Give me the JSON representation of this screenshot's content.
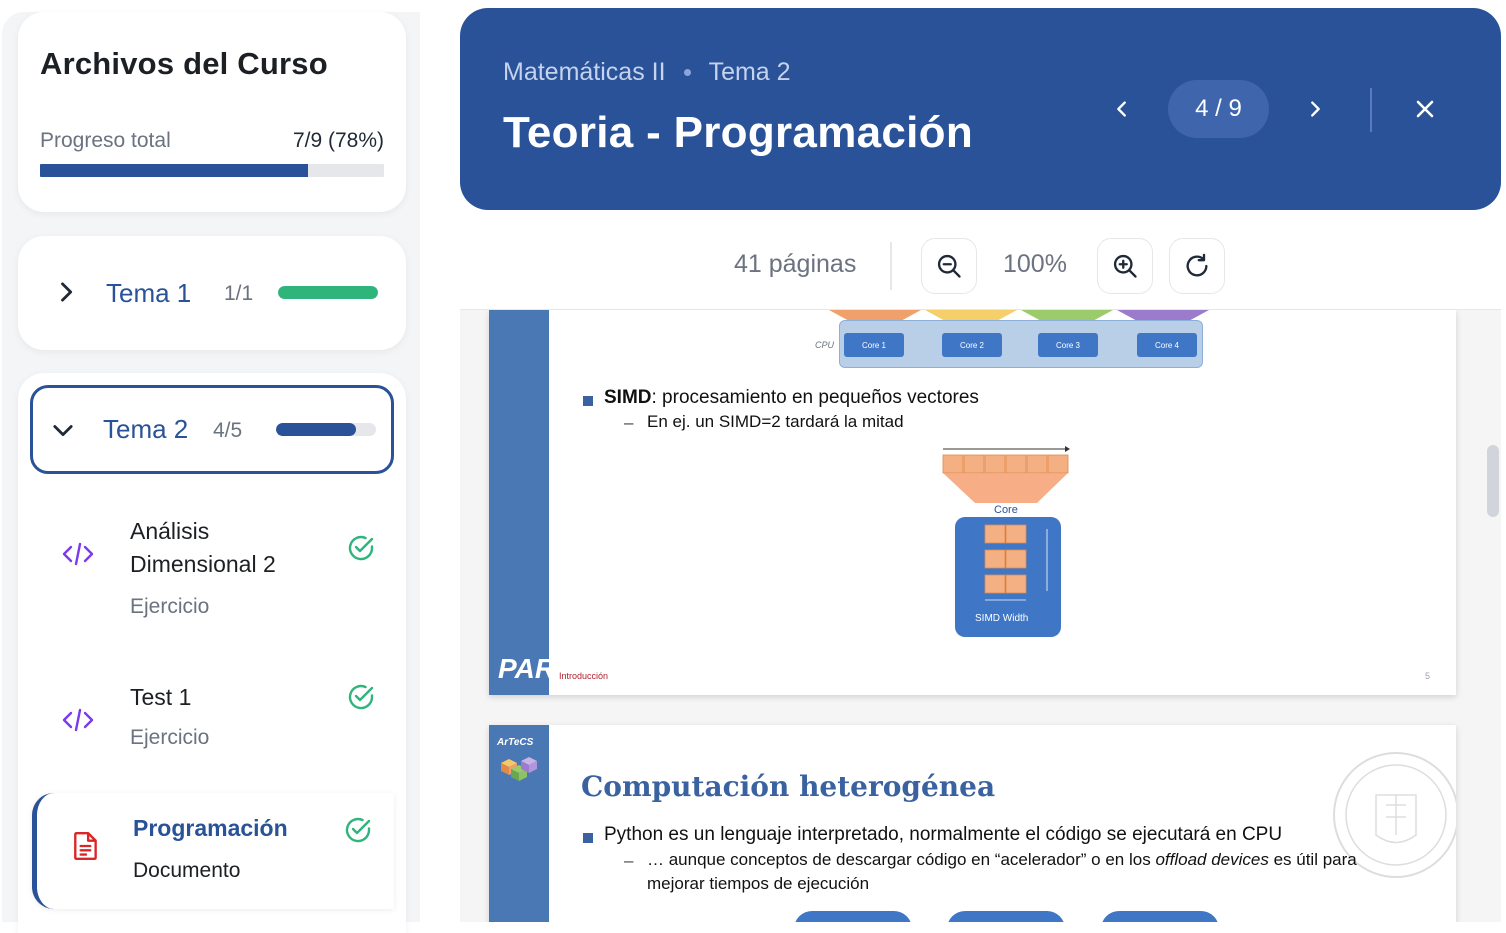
{
  "sidebar": {
    "title": "Archivos del Curso",
    "progress": {
      "label": "Progreso total",
      "value_text": "7/9 (78%)",
      "fraction": 0.78
    },
    "temas": [
      {
        "name": "Tema 1",
        "count": "1/1",
        "fraction": 1.0,
        "color": "#2fb47c",
        "expanded": false
      },
      {
        "name": "Tema 2",
        "count": "4/5",
        "fraction": 0.8,
        "color": "#2a5298",
        "expanded": true
      }
    ],
    "items": [
      {
        "title": "Análisis Dimensional 2",
        "type": "Ejercicio",
        "icon": "code-icon",
        "completed": true
      },
      {
        "title": "Test 1",
        "type": "Ejercicio",
        "icon": "code-icon",
        "completed": true
      },
      {
        "title": "Programación",
        "type": "Documento",
        "icon": "document-icon",
        "completed": true,
        "active": true
      }
    ]
  },
  "header": {
    "breadcrumb": [
      "Matemáticas II",
      "Tema 2"
    ],
    "title": "Teoria - Programación",
    "page_indicator": "4 / 9"
  },
  "viewer": {
    "pages_label": "41 páginas",
    "zoom_label": "100%"
  },
  "slides": {
    "slide1": {
      "cpu_label": "CPU",
      "cores": [
        "Core 1",
        "Core 2",
        "Core 3",
        "Core 4"
      ],
      "bullet_bold": "SIMD",
      "bullet_rest": ": procesamiento en pequeños vectores",
      "sub": "En ej. un SIMD=2 tardará la mitad",
      "core_label": "Core",
      "simd_width": "SIMD Width",
      "footer": "Introducción",
      "page_num": "5",
      "logo": "PAR"
    },
    "slide2": {
      "logo": "ArTeCS",
      "title": "Computación heterogénea",
      "bullet": "Python es un lenguaje interpretado, normalmente el código se ejecutará en CPU",
      "sub_before": "… aunque conceptos de descargar código en “acelerador” o en los ",
      "sub_italic": "offload devices",
      "sub_after": " es útil para",
      "sub_line2": "mejorar tiempos de ejecución"
    }
  },
  "colors": {
    "brand": "#2a5298",
    "success": "#2fb47c",
    "code_icon": "#7c3aed",
    "doc_icon": "#dc2626"
  }
}
